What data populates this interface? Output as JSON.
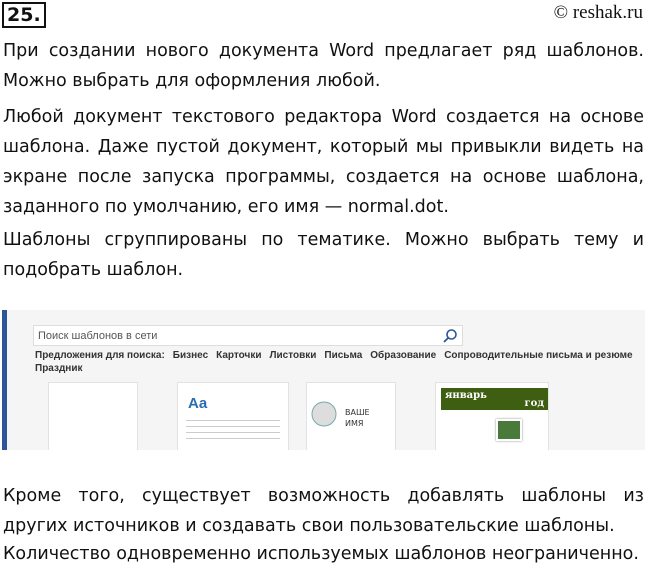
{
  "header": {
    "number": "25.",
    "copyright": "© reshak.ru"
  },
  "paragraphs_top": [
    "При создании нового документа Word предлагает ряд шаблонов. Можно выбрать для оформления любой.",
    "Любой документ текстового редактора Word создается на основе шаблона. Даже пустой документ, который мы привыкли видеть на экране после запуска программы, создается на основе шаблона, заданного по умолчанию, его имя — normal.dot.",
    "Шаблоны сгруппированы по тематике. Можно выбрать тему и подобрать шаблон."
  ],
  "screenshot": {
    "search_placeholder": "Поиск шаблонов в сети",
    "suggestions_label": "Предложения для поиска:",
    "suggestions": [
      "Бизнес",
      "Карточки",
      "Листовки",
      "Письма",
      "Образование",
      "Сопроводительные письма и резюме",
      "Праздник"
    ],
    "card_aa": "Aa",
    "card_resume": "ВАШЕ ИМЯ",
    "card_calendar": "январь",
    "card_calendar_year": "год",
    "accent": "#2b579a"
  },
  "paragraphs_bottom": [
    "Кроме того, существует возможность добавлять шаблоны из других источников и создавать свои пользовательские шаблоны.",
    "Количество одновременно используемых шаблонов неограниченно."
  ],
  "watermark": "reshak.ru"
}
